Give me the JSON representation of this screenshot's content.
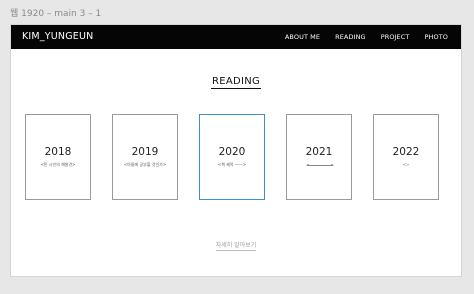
{
  "frame": {
    "label": "웹 1920 – main 3 – 1"
  },
  "header": {
    "brand": "KIM_YUNGEUN",
    "nav": [
      "ABOUT ME",
      "READING",
      "PROJECT",
      "PHOTO"
    ]
  },
  "section": {
    "title": "READING"
  },
  "cards": [
    {
      "year": "2018",
      "subtitle": "<민 시인의 해발견>"
    },
    {
      "year": "2019",
      "subtitle": "<아들에 공부할 것인가>"
    },
    {
      "year": "2020",
      "subtitle": "<책 제목 ——>"
    },
    {
      "year": "2021",
      "subtitle": ""
    },
    {
      "year": "2022",
      "subtitle": "<>"
    }
  ],
  "more": {
    "label": "자세히 알아보기"
  },
  "colors": {
    "active_border": "#3a8fd0",
    "navbar": "#050505"
  }
}
